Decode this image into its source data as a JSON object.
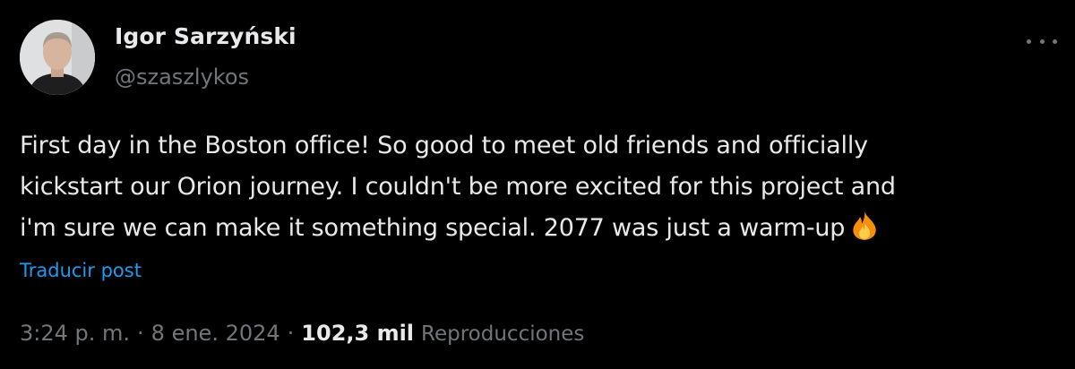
{
  "author": {
    "display_name": "Igor Sarzyński",
    "handle": "@szaszlykos"
  },
  "tweet": {
    "text_lines": [
      "First day in the Boston office! So good to meet old friends and officially",
      "kickstart our Orion journey. I couldn't be more excited for this project and",
      "i'm sure we can make it something special. 2077 was just a warm-up"
    ],
    "emoji": "fire-icon",
    "translate_label": "Traducir post"
  },
  "meta": {
    "time": "3:24 p. m.",
    "separator": "·",
    "date": "8 ene. 2024",
    "views_count": "102,3 mil",
    "views_label": "Reproducciones"
  },
  "colors": {
    "background": "#000000",
    "primary_text": "#e7e9ea",
    "secondary_text": "#71767b",
    "link": "#1d9bf0"
  }
}
